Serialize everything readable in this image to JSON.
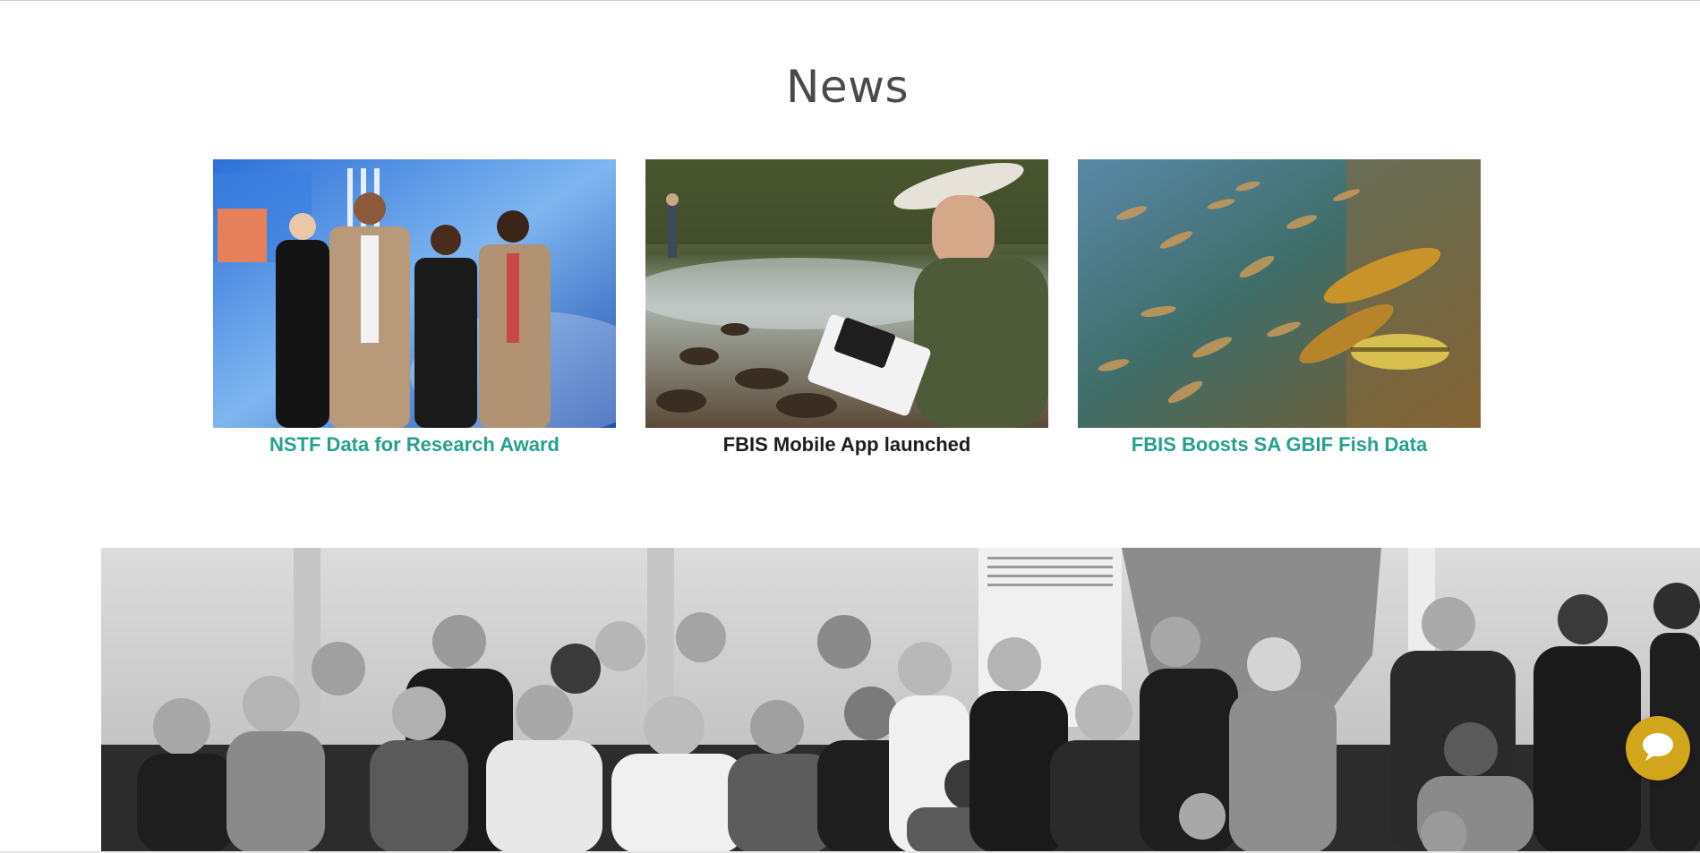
{
  "news": {
    "title": "News",
    "items": [
      {
        "caption": "NSTF Data for Research Award",
        "caption_color": "#26a08e"
      },
      {
        "caption": "FBIS Mobile App launched",
        "caption_color": "#1d1d1d"
      },
      {
        "caption": "FBIS Boosts SA GBIF Fish Data",
        "caption_color": "#26a08e"
      }
    ]
  },
  "team_photo": {
    "style": "black-and-white group photo"
  },
  "chat": {
    "icon": "speech-bubble-icon",
    "color": "#d2a61c"
  },
  "colors": {
    "accent": "#26a08e",
    "heading": "#4a4a4a"
  }
}
